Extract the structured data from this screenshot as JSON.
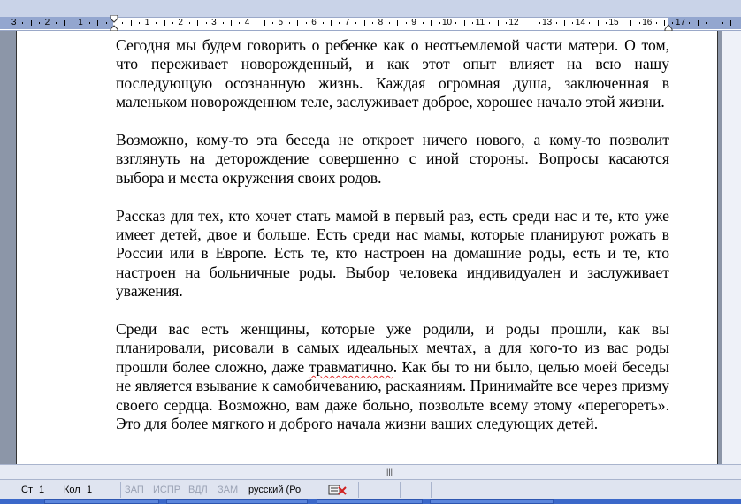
{
  "ruler": {
    "labels": [
      "3",
      "2",
      "1",
      "1",
      "2",
      "3",
      "4",
      "5",
      "6",
      "7",
      "8",
      "9",
      "10",
      "11",
      "12",
      "13",
      "14",
      "15",
      "16",
      "17"
    ]
  },
  "document": {
    "paragraphs": [
      "Сегодня мы будем говорить о ребенке как о неотъемлемой части матери. О том, что переживает новорожденный, и как этот опыт влияет на всю нашу последующую осознанную жизнь. Каждая огромная душа, заключенная в маленьком новорожденном теле, заслуживает доброе, хорошее начало этой жизни.",
      "Возможно, кому-то эта беседа не откроет ничего нового, а кому-то позволит взглянуть на деторождение совершенно с иной стороны. Вопросы касаются выбора и места окружения своих родов.",
      "Рассказ для тех, кто хочет стать мамой в первый  раз, есть среди нас и те, кто уже имеет детей, двое и больше. Есть среди нас мамы, которые планируют рожать в России или в Европе. Есть те, кто настроен на домашние роды, есть и те, кто настроен на больничные роды. Выбор человека индивидуален и заслуживает уважения."
    ],
    "p4_a": "Среди вас есть женщины, которые уже родили, и роды прошли, как вы планировали, рисовали в самых идеальных мечтах, а для кого-то из вас роды прошли более сложно, даже ",
    "p4_misspelled": "травматично",
    "p4_b": ". Как бы то ни было, целью моей беседы не является взывание к самобичеванию, раскаяниям. Принимайте все через призму своего сердца. Возможно, вам даже больно, позвольте всему этому «перегореть». Это для более мягкого и доброго начала жизни ваших следующих детей."
  },
  "statusbar": {
    "page": "Ст",
    "page_num": "1",
    "column": "Кол",
    "column_num": "1",
    "rec": "ЗАП",
    "trk": "ИСПР",
    "ext": "ВДЛ",
    "ovr": "ЗАМ",
    "language": "русский (Ро"
  },
  "colors": {
    "accent": "#3b68c9",
    "spellcheck": "#e03030"
  }
}
